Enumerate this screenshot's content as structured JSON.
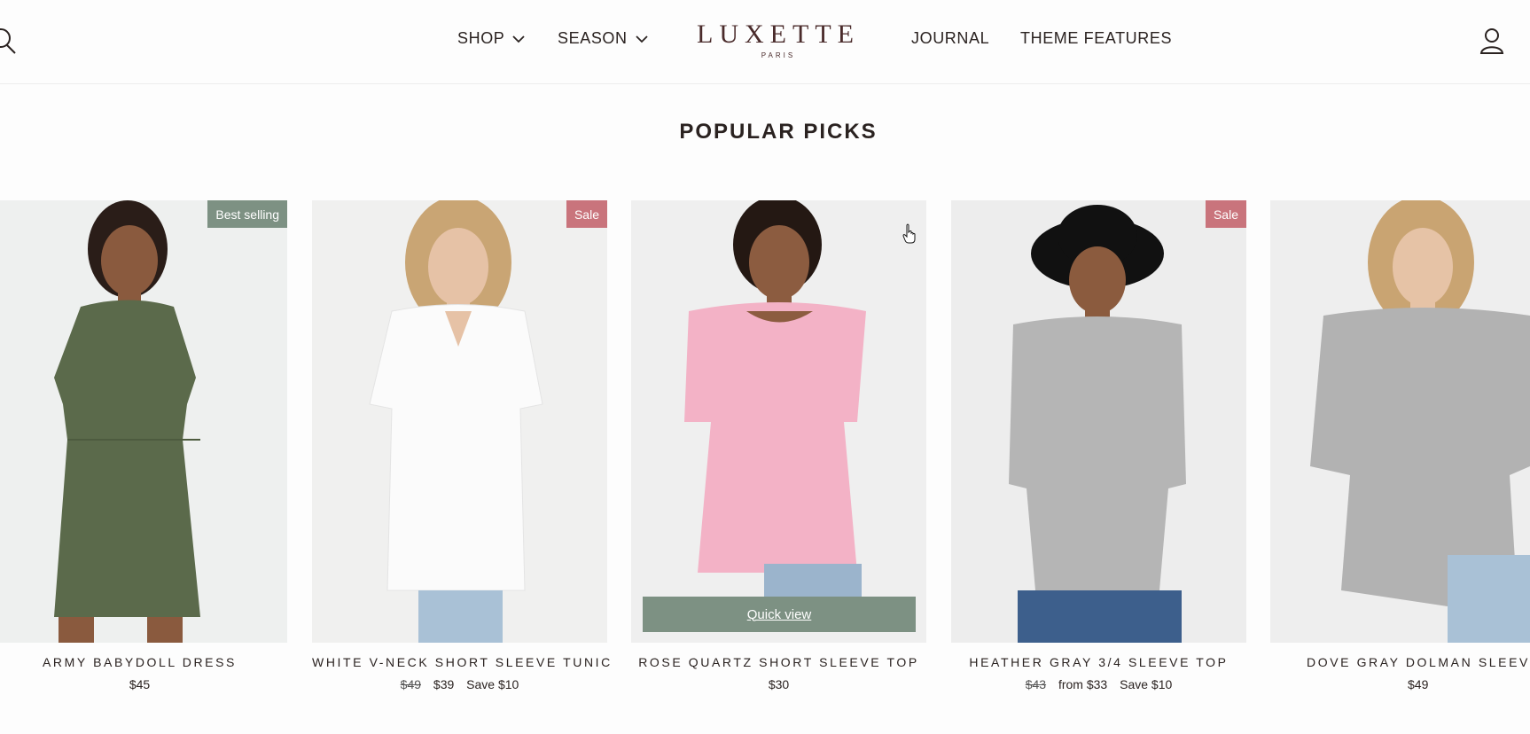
{
  "header": {
    "nav_left": [
      {
        "label": "SHOP",
        "has_dropdown": true
      },
      {
        "label": "SEASON",
        "has_dropdown": true
      }
    ],
    "logo": {
      "main": "LUXETTE",
      "sub": "PARIS"
    },
    "nav_right": [
      {
        "label": "JOURNAL"
      },
      {
        "label": "THEME FEATURES"
      }
    ]
  },
  "section": {
    "title": "POPULAR PICKS"
  },
  "colors": {
    "badge_best_selling": "#7d9183",
    "badge_sale": "#c9747c",
    "quick_view": "#7d9183",
    "logo": "#4a2b2b"
  },
  "products": [
    {
      "title": "ARMY BABYDOLL DRESS",
      "badge": "Best selling",
      "price": "$45"
    },
    {
      "title": "WHITE V-NECK SHORT SLEEVE TUNIC",
      "badge": "Sale",
      "orig_price": "$49",
      "price": "$39",
      "save": "Save $10"
    },
    {
      "title": "ROSE QUARTZ SHORT SLEEVE TOP",
      "price": "$30",
      "quick_view": "Quick view"
    },
    {
      "title": "HEATHER GRAY 3/4 SLEEVE TOP",
      "badge": "Sale",
      "orig_price": "$43",
      "price": "from $33",
      "save": "Save $10"
    },
    {
      "title": "DOVE GRAY DOLMAN SLEEVE",
      "price": "$49"
    }
  ]
}
